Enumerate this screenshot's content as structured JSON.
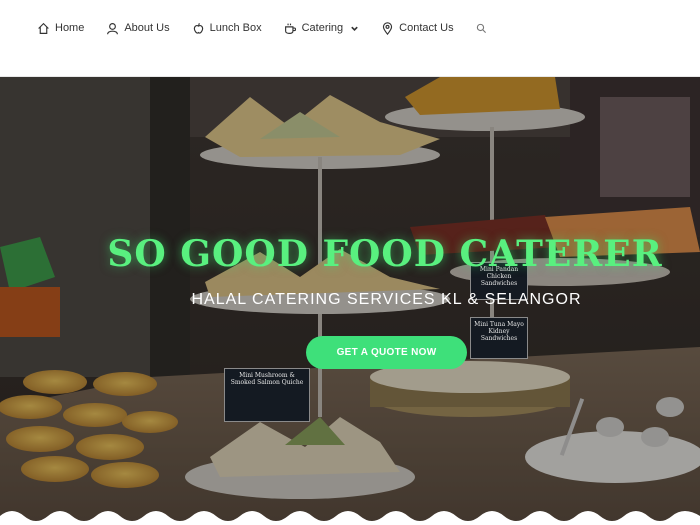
{
  "nav": {
    "items": [
      {
        "label": "Home",
        "icon": "home-icon"
      },
      {
        "label": "About Us",
        "icon": "user-icon"
      },
      {
        "label": "Lunch Box",
        "icon": "apple-icon"
      },
      {
        "label": "Catering",
        "icon": "cup-icon",
        "has_dropdown": true
      },
      {
        "label": "Contact Us",
        "icon": "map-pin-icon"
      }
    ],
    "search_icon": "search-icon"
  },
  "hero": {
    "title": "SO GOOD FOOD CATERER",
    "subtitle": "HALAL CATERING SERVICES KL & SELANGOR",
    "cta_label": "GET A QUOTE NOW",
    "signs": {
      "mushroom": "Mini Mushroom & Smoked Salmon Quiche",
      "tea": "Mini Tuna Mayo Kidney Sandwiches",
      "chicken": "Mini Pandan Chicken Sandwiches"
    }
  },
  "colors": {
    "accent_green": "#59f07f",
    "cta_green": "#3ee07a",
    "nav_text": "#333333"
  }
}
